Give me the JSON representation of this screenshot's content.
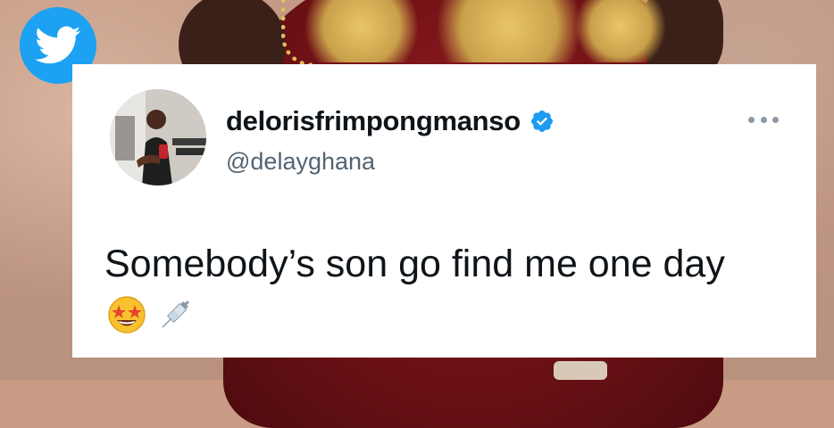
{
  "brand": {
    "logo_icon": "twitter-bird-icon",
    "accent_color": "#1da1f2"
  },
  "tweet": {
    "display_name": "delorisfrimpongmanso",
    "handle": "@delayghana",
    "verified": true,
    "verified_icon": "verified-badge-icon",
    "verified_color": "#1d9bf0",
    "text": "Somebody’s son go find me one day",
    "emojis": [
      "star-struck-emoji",
      "syringe-emoji"
    ],
    "more_icon": "more-options-icon"
  }
}
